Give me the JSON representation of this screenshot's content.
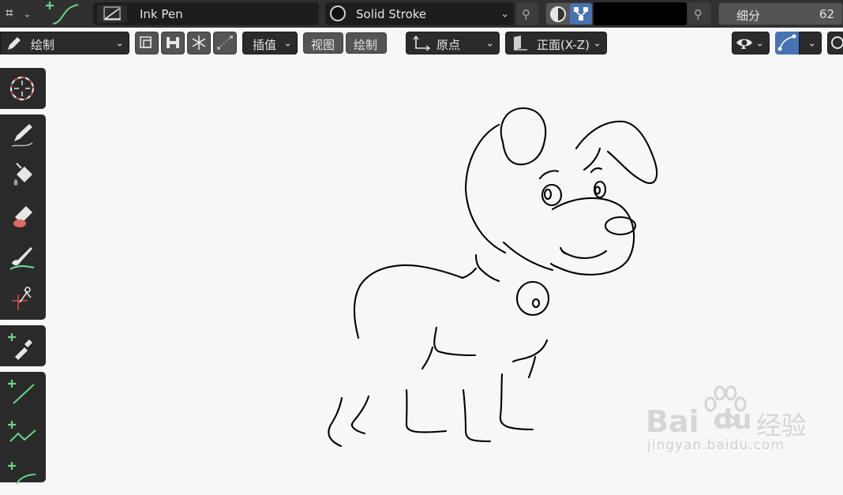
{
  "header": {
    "brush_name": "Ink Pen",
    "stroke_material": "Solid Stroke",
    "subdivision_label": "细分",
    "subdivision_value": "62",
    "color_swatch": "#000000"
  },
  "toolbar": {
    "mode_label": "绘制",
    "interp_label": "插值",
    "view_label": "视图",
    "draw_label": "绘制",
    "origin_label": "原点",
    "plane_label": "正面(X-Z)"
  },
  "tools": [
    {
      "name": "cursor-tool",
      "icon": "crosshair-icon"
    },
    {
      "name": "draw-tool",
      "icon": "pencil-icon"
    },
    {
      "name": "fill-tool",
      "icon": "paint-bucket-icon"
    },
    {
      "name": "erase-tool",
      "icon": "eraser-icon"
    },
    {
      "name": "tint-tool",
      "icon": "brush-tint-icon"
    },
    {
      "name": "cutter-tool",
      "icon": "scissors-icon"
    },
    {
      "name": "eyedropper-tool",
      "icon": "eyedropper-icon"
    },
    {
      "name": "line-tool",
      "icon": "line-icon"
    },
    {
      "name": "polyline-tool",
      "icon": "polyline-icon"
    },
    {
      "name": "arc-tool",
      "icon": "arc-icon"
    }
  ],
  "watermark": {
    "brand": "Bai",
    "brand2": "du",
    "suffix": "经验",
    "url": "jingyan.baidu.com"
  },
  "colors": {
    "active_blue": "#4772b3",
    "add_green": "#6ad48a"
  }
}
